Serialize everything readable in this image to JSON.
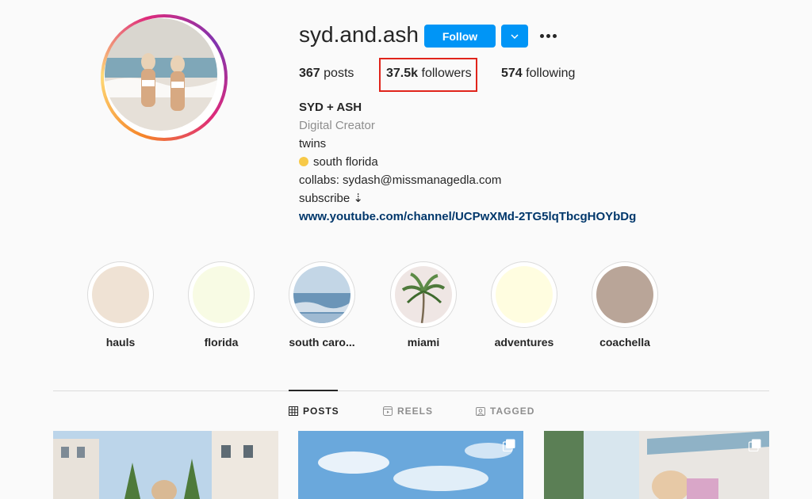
{
  "profile": {
    "username": "syd.and.ash",
    "follow_label": "Follow",
    "stats": {
      "posts_count": "367",
      "posts_label": "posts",
      "followers_count": "37.5k",
      "followers_label": "followers",
      "following_count": "574",
      "following_label": "following"
    },
    "bio": {
      "name": "SYD + ASH",
      "category": "Digital Creator",
      "line1": "twins",
      "location": "south florida",
      "collabs": "collabs: sydash@missmanagedla.com",
      "subscribe": "subscribe ⇣",
      "link": "www.youtube.com/channel/UCPwXMd-2TG5lqTbcgHOYbDg"
    }
  },
  "highlights": [
    {
      "label": "hauls",
      "color": "#efe2d4"
    },
    {
      "label": "florida",
      "color": "#f8fbe4"
    },
    {
      "label": "south caro...",
      "color": "#a8c4dc"
    },
    {
      "label": "miami",
      "color": "#efe6e4"
    },
    {
      "label": "adventures",
      "color": "#fffde0"
    },
    {
      "label": "coachella",
      "color": "#b9a598"
    }
  ],
  "tabs": [
    {
      "label": "POSTS",
      "icon": "grid-icon",
      "active": true
    },
    {
      "label": "REELS",
      "icon": "reels-icon",
      "active": false
    },
    {
      "label": "TAGGED",
      "icon": "tagged-icon",
      "active": false
    }
  ],
  "colors": {
    "accent": "#0095f6",
    "highlight_box": "#e0241b",
    "link": "#00376b"
  }
}
